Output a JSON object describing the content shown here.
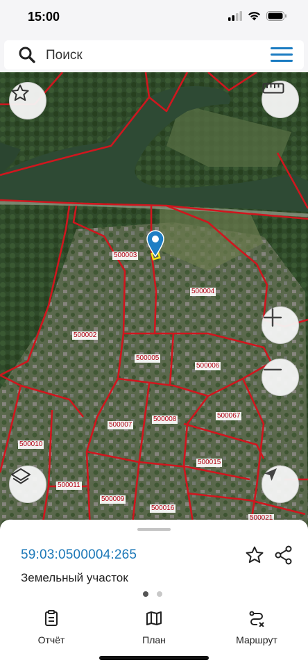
{
  "status_bar": {
    "time": "15:00"
  },
  "search": {
    "placeholder": "Поиск"
  },
  "map": {
    "parcels": [
      {
        "id": "p500003",
        "label": "500003"
      },
      {
        "id": "p500004",
        "label": "500004"
      },
      {
        "id": "p500002",
        "label": "500002"
      },
      {
        "id": "p500005",
        "label": "500005"
      },
      {
        "id": "p500006",
        "label": "500006"
      },
      {
        "id": "p500067",
        "label": "500067"
      },
      {
        "id": "p500007",
        "label": "500007"
      },
      {
        "id": "p500008",
        "label": "500008"
      },
      {
        "id": "p500010",
        "label": "500010"
      },
      {
        "id": "p500015",
        "label": "500015"
      },
      {
        "id": "p500011",
        "label": "500011"
      },
      {
        "id": "p500009",
        "label": "500009"
      },
      {
        "id": "p500016",
        "label": "500016"
      },
      {
        "id": "p500021",
        "label": "500021"
      }
    ]
  },
  "sheet": {
    "cadastral_number": "59:03:0500004:265",
    "object_type": "Земельный участок"
  },
  "tabs": [
    {
      "label": "Отчёт",
      "icon": "report-icon"
    },
    {
      "label": "План",
      "icon": "map-plan-icon"
    },
    {
      "label": "Маршрут",
      "icon": "route-icon"
    }
  ],
  "colors": {
    "accent": "#1a7bc1",
    "boundary": "#d0161e",
    "label_text": "#b00010",
    "water": "#2e4a34"
  }
}
